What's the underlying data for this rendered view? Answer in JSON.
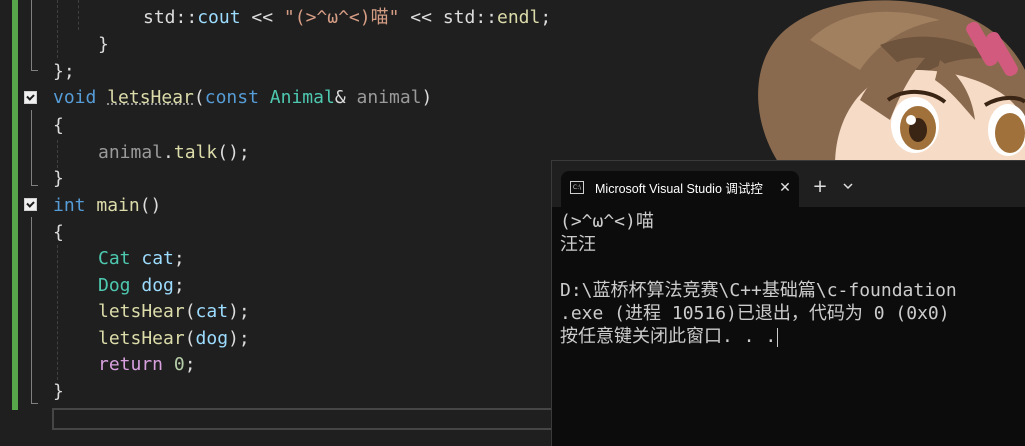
{
  "editor": {
    "lines": {
      "l1_a": "std::",
      "l1_b": "cout",
      "l1_c": " << ",
      "l1_d": "\"(>^ω^<)喵\"",
      "l1_e": " << ",
      "l1_f": "std::",
      "l1_g": "endl",
      "l1_h": ";",
      "l2": "}",
      "l3": "};",
      "l4_kw": "void",
      "l4_fn": "letsHear",
      "l4_p1": "(",
      "l4_const": "const",
      "l4_ty": "Animal",
      "l4_amp": "& ",
      "l4_param": "animal",
      "l4_p2": ")",
      "l5": "{",
      "l6_obj": "animal",
      "l6_dot": ".",
      "l6_fn": "talk",
      "l6_rest": "();",
      "l7": "}",
      "l8_kw": "int",
      "l8_fn": "main",
      "l8_rest": "()",
      "l9": "{",
      "l10_ty": "Cat",
      "l10_var": "cat",
      "l10_semi": ";",
      "l11_ty": "Dog",
      "l11_var": "dog",
      "l11_semi": ";",
      "l12_fn": "letsHear",
      "l12_p1": "(",
      "l12_var": "cat",
      "l12_p2": ");",
      "l13_fn": "letsHear",
      "l13_p1": "(",
      "l13_var": "dog",
      "l13_p2": ");",
      "l14_kw": "return",
      "l14_num": "0",
      "l14_semi": ";",
      "l15": "}"
    }
  },
  "console": {
    "tab_title": "Microsoft Visual Studio 调试控制台",
    "tab_icon_text": "C:\\",
    "close_glyph": "✕",
    "new_tab_glyph": "+",
    "output": [
      "(>^ω^<)喵",
      "汪汪",
      "",
      "D:\\蓝桥杯算法竞赛\\C++基础篇\\c-foundation",
      ".exe (进程 10516)已退出，代码为 0 (0x0)",
      "按任意键关闭此窗口. . ."
    ]
  },
  "colors": {
    "editor_bg": "#1f1f1f",
    "keyword": "#569cd6",
    "type": "#4ec9b0",
    "function": "#dcdcaa",
    "string": "#d69d85",
    "variable": "#9cdcfe",
    "control": "#d8a0df",
    "change_bar": "#57a64a",
    "console_bg": "#0c0c0c"
  },
  "icons": {
    "fold": "collapse-icon",
    "console_tab": "console-icon",
    "close": "close-icon",
    "add": "plus-icon",
    "dropdown": "chevron-down-icon"
  }
}
